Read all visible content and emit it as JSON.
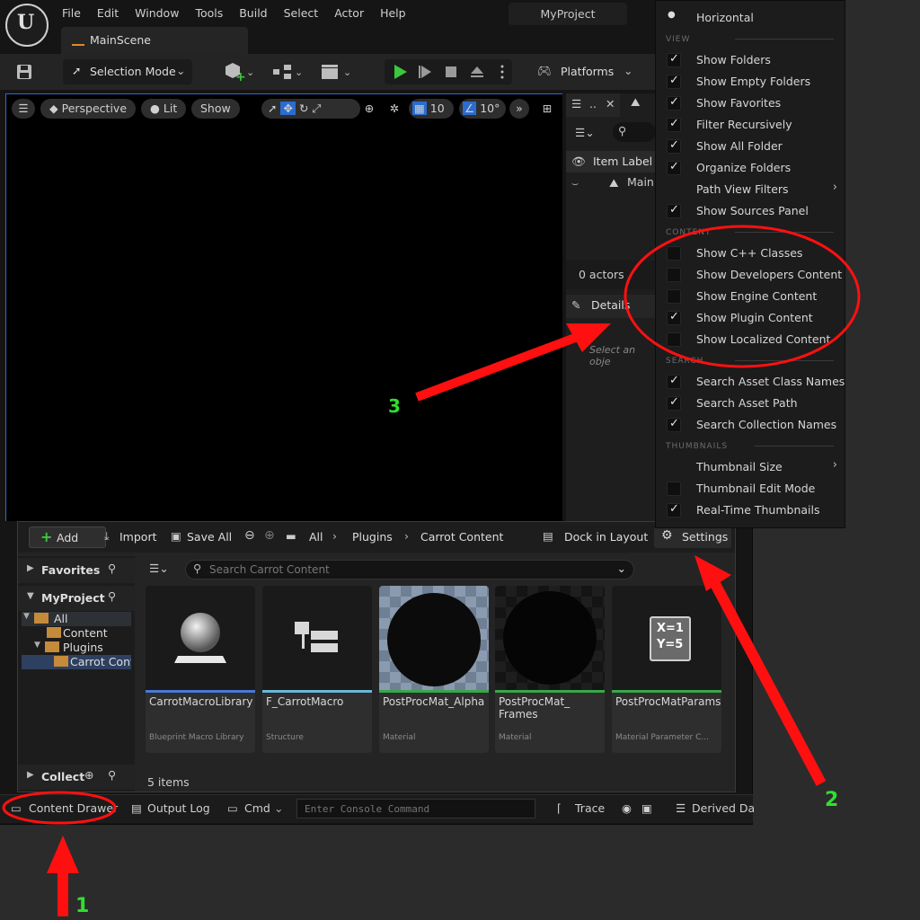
{
  "menubar": {
    "items": [
      "File",
      "Edit",
      "Window",
      "Tools",
      "Build",
      "Select",
      "Actor",
      "Help"
    ]
  },
  "project_name": "MyProject",
  "level_tab": "MainScene",
  "toolbar": {
    "mode": "Selection Mode",
    "platforms": "Platforms"
  },
  "viewport": {
    "perspective": "Perspective",
    "lit": "Lit",
    "show": "Show",
    "grid": "10",
    "angle": "10°"
  },
  "outliner": {
    "col": "Item Label",
    "row": "Main",
    "actors": "0 actors",
    "details": "Details",
    "select_hint": "Select an obje"
  },
  "settings_menu": {
    "horizontal": "Horizontal",
    "sections": {
      "view": "VIEW",
      "content": "CONTENT",
      "search": "SEARCH",
      "thumbnails": "THUMBNAILS"
    },
    "view_items": [
      {
        "label": "Show Folders",
        "checked": true
      },
      {
        "label": "Show Empty Folders",
        "checked": true
      },
      {
        "label": "Show Favorites",
        "checked": true
      },
      {
        "label": "Filter Recursively",
        "checked": true
      },
      {
        "label": "Show All Folder",
        "checked": true
      },
      {
        "label": "Organize Folders",
        "checked": true
      },
      {
        "label": "Path View Filters",
        "checked": null,
        "submenu": true
      },
      {
        "label": "Show Sources Panel",
        "checked": true
      }
    ],
    "content_items": [
      {
        "label": "Show C++ Classes",
        "checked": false
      },
      {
        "label": "Show Developers Content",
        "checked": false
      },
      {
        "label": "Show Engine Content",
        "checked": false
      },
      {
        "label": "Show Plugin Content",
        "checked": true
      },
      {
        "label": "Show Localized Content",
        "checked": false
      }
    ],
    "search_items": [
      {
        "label": "Search Asset Class Names",
        "checked": true
      },
      {
        "label": "Search Asset Path",
        "checked": true
      },
      {
        "label": "Search Collection Names",
        "checked": true
      }
    ],
    "thumb_items": [
      {
        "label": "Thumbnail Size",
        "checked": null,
        "submenu": true
      },
      {
        "label": "Thumbnail Edit Mode",
        "checked": false
      },
      {
        "label": "Real-Time Thumbnails",
        "checked": true
      }
    ]
  },
  "content_browser": {
    "add": "Add",
    "import": "Import",
    "save_all": "Save All",
    "path": [
      "All",
      "Plugins",
      "Carrot Content"
    ],
    "dock": "Dock in Layout",
    "settings": "Settings",
    "search_placeholder": "Search Carrot Content",
    "favorites": "Favorites",
    "project": "MyProject",
    "collections": "Collect",
    "tree": [
      "All",
      "Content",
      "Plugins",
      "Carrot Conte"
    ],
    "item_count": "5 items",
    "assets": [
      {
        "name": "CarrotMacroLibrary",
        "type": "Blueprint Macro Library",
        "color": "#4a78d6"
      },
      {
        "name": "F_CarrotMacro",
        "type": "Structure",
        "color": "#6ab8d8"
      },
      {
        "name": "PostProcMat_Alpha",
        "type": "Material",
        "color": "#3aa64a"
      },
      {
        "name": "PostProcMat_ Frames",
        "type": "Material",
        "color": "#3aa64a"
      },
      {
        "name": "PostProcMatParams",
        "type": "Material Parameter C...",
        "color": "#3aa64a"
      }
    ],
    "param_icon": [
      "X=1",
      "Y=5"
    ]
  },
  "statusbar": {
    "content_drawer": "Content Drawer",
    "output_log": "Output Log",
    "cmd": "Cmd",
    "console_placeholder": "Enter Console Command",
    "trace": "Trace",
    "derived": "Derived Da"
  },
  "annotations": [
    "1",
    "2",
    "3"
  ],
  "colors": {
    "annotation_red": "#ff1010",
    "annotation_green": "#2ee02e",
    "play_green": "#3cc83c",
    "selection_blue": "#2b6cd0"
  }
}
